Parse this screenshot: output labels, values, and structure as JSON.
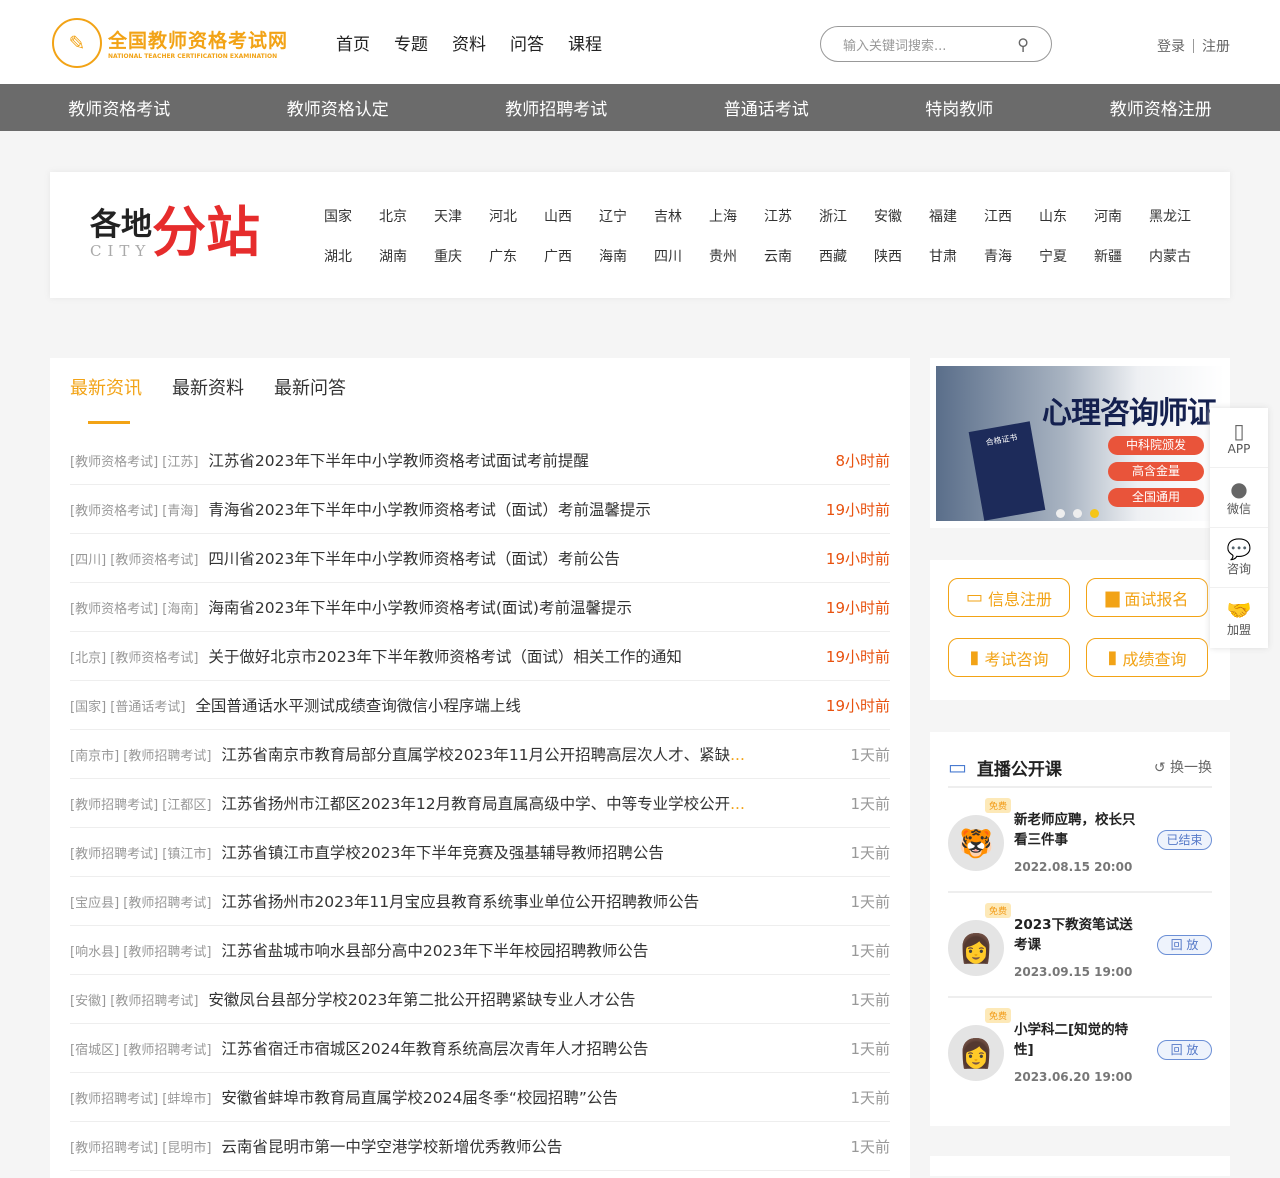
{
  "header": {
    "logo_cn": "全国教师资格考试网",
    "logo_en": "NATIONAL TEACHER CERTIFICATION EXAMINATION",
    "nav": [
      "首页",
      "专题",
      "资料",
      "问答",
      "课程"
    ],
    "search_placeholder": "输入关键词搜索...",
    "login": "登录",
    "register": "注册"
  },
  "catnav": [
    "教师资格考试",
    "教师资格认定",
    "教师招聘考试",
    "普通话考试",
    "特岗教师",
    "教师资格注册"
  ],
  "city": {
    "title_a": "各地",
    "title_b": "分站",
    "title_en": "CITY",
    "list": [
      "国家",
      "北京",
      "天津",
      "河北",
      "山西",
      "辽宁",
      "吉林",
      "上海",
      "江苏",
      "浙江",
      "安徽",
      "福建",
      "江西",
      "山东",
      "河南",
      "黑龙江",
      "湖北",
      "湖南",
      "重庆",
      "广东",
      "广西",
      "海南",
      "四川",
      "贵州",
      "云南",
      "西藏",
      "陕西",
      "甘肃",
      "青海",
      "宁夏",
      "新疆",
      "内蒙古"
    ]
  },
  "tabs": [
    "最新资讯",
    "最新资料",
    "最新问答"
  ],
  "news": [
    {
      "tags": "[教师资格考试] [江苏]",
      "title": "江苏省2023年下半年中小学教师资格考试面试考前提醒",
      "time": "8小时前",
      "hot": true
    },
    {
      "tags": "[教师资格考试] [青海]",
      "title": "青海省2023年下半年中小学教师资格考试（面试）考前温馨提示",
      "time": "19小时前",
      "hot": true
    },
    {
      "tags": "[四川] [教师资格考试]",
      "title": "四川省2023年下半年中小学教师资格考试（面试）考前公告",
      "time": "19小时前",
      "hot": true
    },
    {
      "tags": "[教师资格考试] [海南]",
      "title": "海南省2023年下半年中小学教师资格考试(面试)考前温馨提示",
      "time": "19小时前",
      "hot": true
    },
    {
      "tags": "[北京] [教师资格考试]",
      "title": "关于做好北京市2023年下半年教师资格考试（面试）相关工作的通知",
      "time": "19小时前",
      "hot": true
    },
    {
      "tags": "[国家] [普通话考试]",
      "title": "全国普通话水平测试成绩查询微信小程序端上线",
      "time": "19小时前",
      "hot": true
    },
    {
      "tags": "[南京市] [教师招聘考试]",
      "title": "江苏省南京市教育局部分直属学校2023年11月公开招聘高层次人才、紧缺",
      "ellipsis": "...",
      "time": "1天前",
      "hot": false
    },
    {
      "tags": "[教师招聘考试] [江都区]",
      "title": "江苏省扬州市江都区2023年12月教育局直属高级中学、中等专业学校公开",
      "ellipsis": "...",
      "time": "1天前",
      "hot": false
    },
    {
      "tags": "[教师招聘考试] [镇江市]",
      "title": "江苏省镇江市直学校2023年下半年竞赛及强基辅导教师招聘公告",
      "time": "1天前",
      "hot": false
    },
    {
      "tags": "[宝应县] [教师招聘考试]",
      "title": "江苏省扬州市2023年11月宝应县教育系统事业单位公开招聘教师公告",
      "time": "1天前",
      "hot": false
    },
    {
      "tags": "[响水县] [教师招聘考试]",
      "title": "江苏省盐城市响水县部分高中2023年下半年校园招聘教师公告",
      "time": "1天前",
      "hot": false
    },
    {
      "tags": "[安徽] [教师招聘考试]",
      "title": "安徽凤台县部分学校2023年第二批公开招聘紧缺专业人才公告",
      "time": "1天前",
      "hot": false
    },
    {
      "tags": "[宿城区] [教师招聘考试]",
      "title": "江苏省宿迁市宿城区2024年教育系统高层次青年人才招聘公告",
      "time": "1天前",
      "hot": false
    },
    {
      "tags": "[教师招聘考试] [蚌埠市]",
      "title": "安徽省蚌埠市教育局直属学校2024届冬季“校园招聘”公告",
      "time": "1天前",
      "hot": false
    },
    {
      "tags": "[教师招聘考试] [昆明市]",
      "title": "云南省昆明市第一中学空港学校新增优秀教师公告",
      "time": "1天前",
      "hot": false
    }
  ],
  "banner": {
    "headline": "心理咨询师证",
    "pills": [
      "中科院颁发",
      "高含金量",
      "全国通用"
    ],
    "cert": "合格证书",
    "slide_index": 3,
    "slide_count": 3
  },
  "quick": [
    "信息注册",
    "面试报名",
    "考试咨询",
    "成绩查询"
  ],
  "side": [
    "APP",
    "微信",
    "咨询",
    "加盟"
  ],
  "live": {
    "title": "直播公开课",
    "refresh": "换一换",
    "free": "免费",
    "courses": [
      {
        "name": "新老师应聘，校长只看三件事",
        "date": "2022.08.15 20:00",
        "status": "已结束"
      },
      {
        "name": "2023下教资笔试送考课",
        "date": "2023.09.15 19:00",
        "status": "回 放"
      },
      {
        "name": "小学科二[知觉的特性]",
        "date": "2023.06.20 19:00",
        "status": "回 放"
      }
    ]
  }
}
